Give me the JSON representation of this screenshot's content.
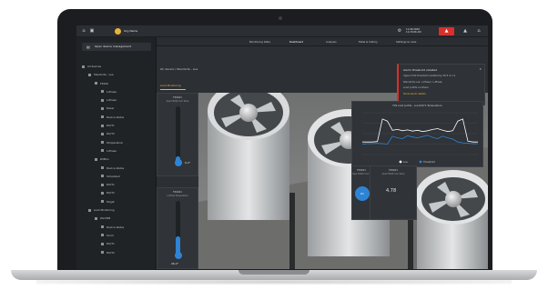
{
  "topbar": {
    "org_name": "Org Name",
    "date": "11.09.2020",
    "time": "11:15:06 AM",
    "icons": [
      "home-icon",
      "dashboard-icon",
      "settings-icon",
      "bell-icon",
      "user-icon",
      "grid-icon"
    ]
  },
  "sidebar": {
    "open_button": "Open device management",
    "items": [
      {
        "label": "All devices",
        "level": 0
      },
      {
        "label": "Standorte - Lua",
        "level": 1
      },
      {
        "label": "F4940",
        "level": 2
      },
      {
        "label": "L-Phase",
        "level": 3
      },
      {
        "label": "L-Phase",
        "level": 3
      },
      {
        "label": "Power",
        "level": 3
      },
      {
        "label": "Device status",
        "level": 3
      },
      {
        "label": "DO/T1",
        "level": 3
      },
      {
        "label": "DO/T2",
        "level": 3
      },
      {
        "label": "Temperature",
        "level": 3
      },
      {
        "label": "L-Phase",
        "level": 3
      },
      {
        "label": "D2Mon",
        "level": 2
      },
      {
        "label": "Device status",
        "level": 3
      },
      {
        "label": "Scheduled",
        "level": 3
      },
      {
        "label": "DO/T1",
        "level": 3
      },
      {
        "label": "DO/T2",
        "level": 3
      },
      {
        "label": "Target",
        "level": 3
      },
      {
        "label": "Load Monitoring",
        "level": 1
      },
      {
        "label": "ZG1308",
        "level": 2
      },
      {
        "label": "Device status",
        "level": 3
      },
      {
        "label": "Scroll",
        "level": 3
      },
      {
        "label": "DO/T1",
        "level": 3
      },
      {
        "label": "DO/T2",
        "level": 3
      }
    ]
  },
  "tabs": [
    {
      "label": "Monitoring table",
      "active": false
    },
    {
      "label": "Dashboard",
      "active": true
    },
    {
      "label": "Analysis",
      "active": false
    },
    {
      "label": "Table & history",
      "active": false
    },
    {
      "label": "Settings & rules",
      "active": false
    }
  ],
  "breadcrumb": "On device / Standorte - Lua",
  "subtab": "Load Monitoring",
  "thermometer_1": {
    "title": "F49401",
    "subtitle": "Oper.F4940 Cool Temp",
    "value": "0.2°",
    "level": 0.12
  },
  "thermometer_2": {
    "title": "F49401",
    "subtitle": "L-Phase Temperature",
    "value": "26.2°",
    "level": 0.35
  },
  "alarm_popup": {
    "title": "Alarm threshold violated",
    "lines": [
      "Upper limit threshold violated by 50.5 on L1",
      "Standorte Lua: L-Phase / L-Phase",
      "Load profile L1-Power",
      "Show alarm details"
    ]
  },
  "trend_chart": {
    "title": "F49 Load profile - Lua DO/T1 Temperature"
  },
  "chart_data": {
    "type": "line",
    "title": "F49 Load profile - Lua DO/T1 Temperature",
    "xlabel": "",
    "ylabel": "",
    "grid": true,
    "legend": "bottom",
    "legend_entries": [
      "Lua",
      "Threshold"
    ],
    "series": [
      {
        "name": "Lua",
        "color": "#ffffff",
        "values": [
          30,
          30,
          30,
          31,
          85,
          80,
          58,
          60,
          57,
          59,
          56,
          58,
          55,
          57,
          60,
          62,
          58,
          55,
          57,
          80,
          85,
          32,
          30,
          30
        ]
      },
      {
        "name": "Threshold",
        "color": "#2e84d4",
        "values": [
          25,
          26,
          26,
          27,
          26,
          25,
          44,
          40,
          38,
          45,
          42,
          40,
          43,
          46,
          41,
          38,
          44,
          40,
          37,
          30,
          28,
          27,
          26,
          26
        ]
      }
    ],
    "ylim": [
      0,
      100
    ]
  },
  "gauge_card": {
    "title": "F49401",
    "subtitle": "Oper.F4940 Cool Temp"
  },
  "value_card": {
    "title": "F49401",
    "subtitle": "Oper.F4940 Cool Temp",
    "value": "4.78"
  },
  "toggle_label": "On",
  "colors": {
    "accent": "#e8b43c",
    "alarm": "#d9302c",
    "blue": "#2e84d4"
  }
}
